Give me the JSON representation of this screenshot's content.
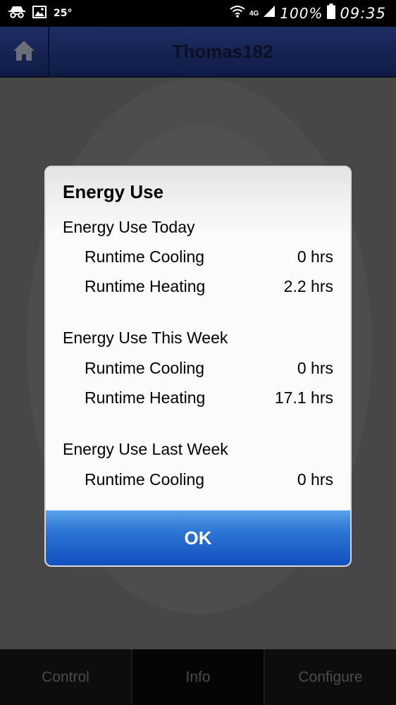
{
  "status_bar": {
    "temperature": "25°",
    "network": "4G",
    "battery": "100%",
    "time": "09:35",
    "icons": [
      "incognito-icon",
      "gallery-icon",
      "wifi-icon",
      "signal-icon",
      "battery-icon"
    ]
  },
  "header": {
    "title": "Thomas182",
    "home_icon": "home-icon"
  },
  "dialog": {
    "title": "Energy Use",
    "sections": [
      {
        "title": "Energy Use Today",
        "rows": [
          {
            "label": "Runtime Cooling",
            "value": "0 hrs"
          },
          {
            "label": "Runtime Heating",
            "value": "2.2 hrs"
          }
        ]
      },
      {
        "title": "Energy Use This Week",
        "rows": [
          {
            "label": "Runtime Cooling",
            "value": "0 hrs"
          },
          {
            "label": "Runtime Heating",
            "value": "17.1 hrs"
          }
        ]
      },
      {
        "title": "Energy Use Last Week",
        "rows": [
          {
            "label": "Runtime Cooling",
            "value": "0 hrs"
          }
        ]
      }
    ],
    "ok_label": "OK"
  },
  "tabs": [
    {
      "label": "Control"
    },
    {
      "label": "Info"
    },
    {
      "label": "Configure"
    }
  ],
  "colors": {
    "header_bg": "#1e2d63",
    "ok_button": "#2f78d6",
    "overlay": "#474747"
  }
}
